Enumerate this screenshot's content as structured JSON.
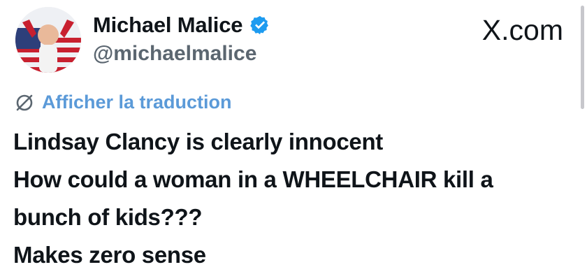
{
  "author": {
    "display_name": "Michael Malice",
    "handle": "@michaelmalice",
    "verified_icon": "verified-badge-icon",
    "avatar_icon": "avatar"
  },
  "brand": {
    "label": "X.com"
  },
  "translate": {
    "icon": "translate-globe-icon",
    "label": "Afficher la traduction"
  },
  "tweet": {
    "lines": [
      "Lindsay Clancy is clearly innocent",
      "How could a woman in a WHEELCHAIR kill a",
      "bunch of kids???",
      "Makes zero sense"
    ]
  },
  "colors": {
    "text": "#0f1419",
    "handle": "#5b6670",
    "link": "#5b9ad8",
    "verified": "#1d9bf0"
  }
}
